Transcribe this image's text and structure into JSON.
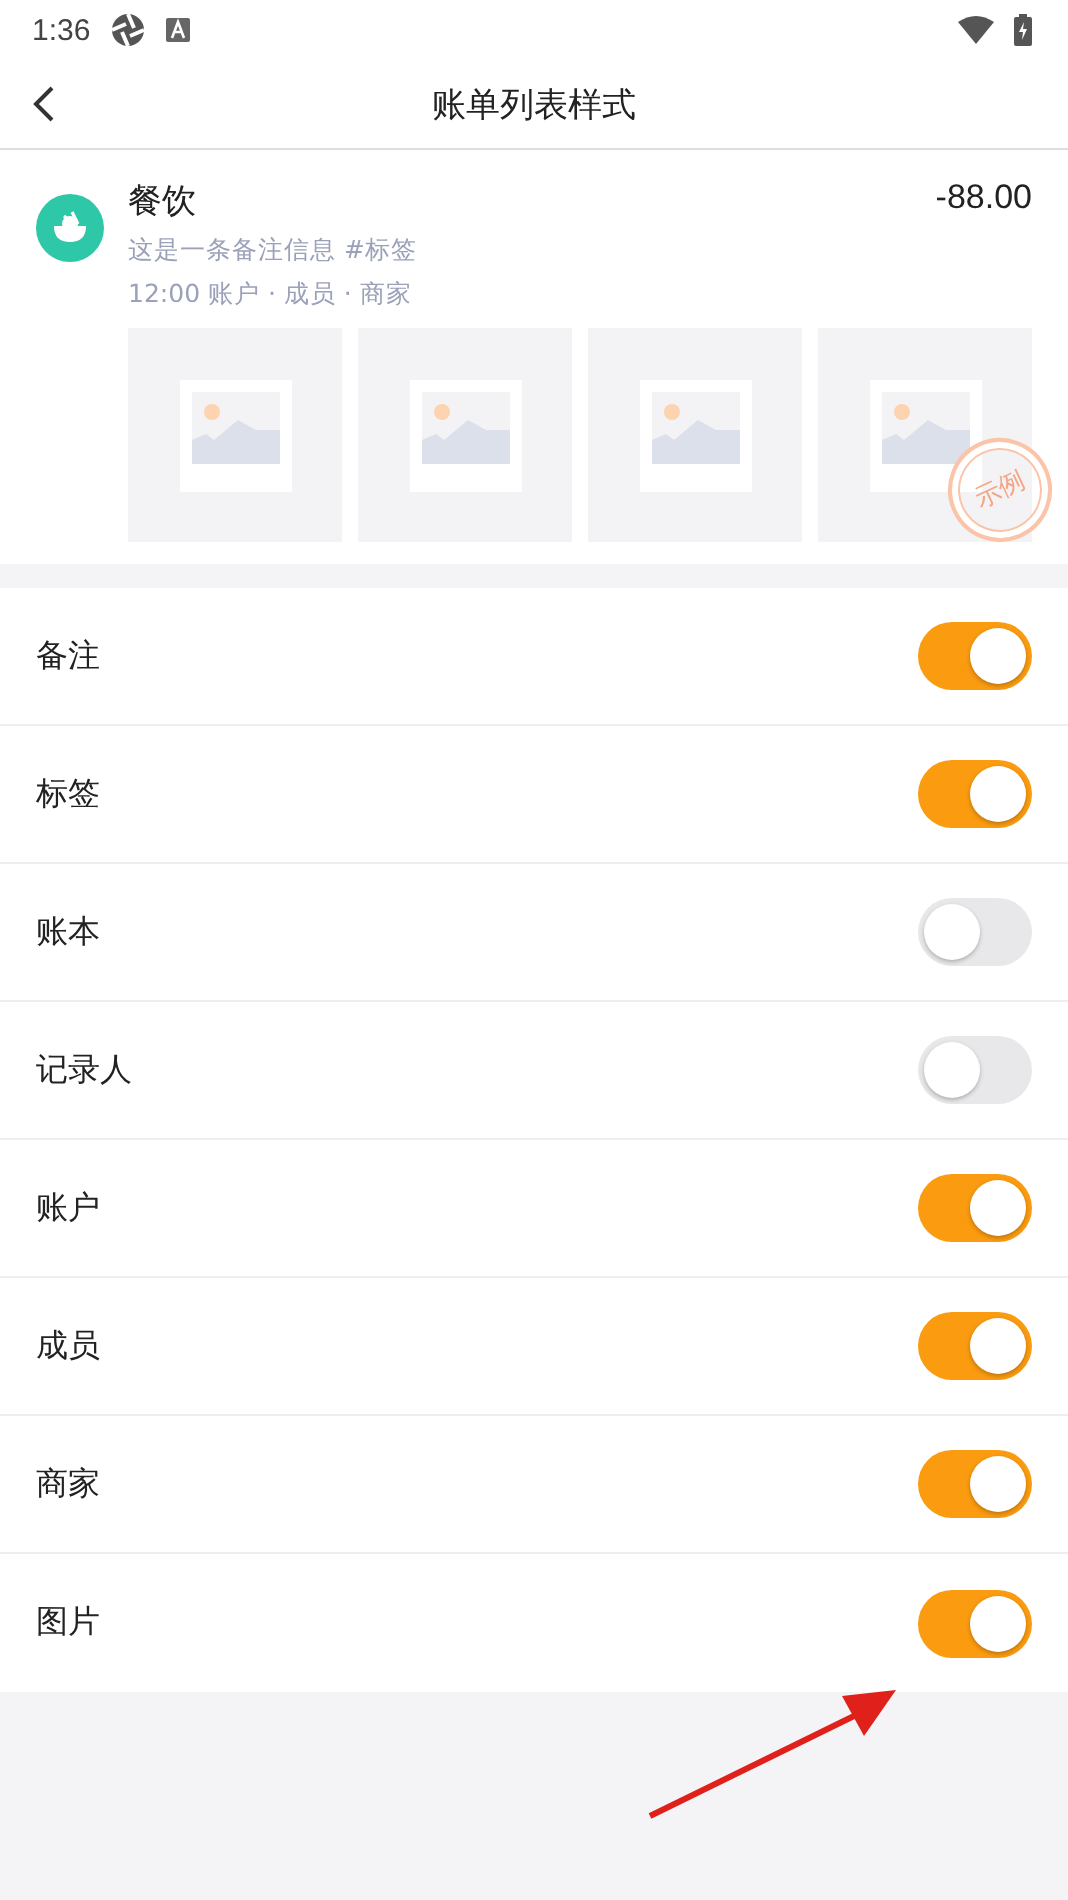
{
  "status_bar": {
    "time": "1:36"
  },
  "header": {
    "title": "账单列表样式"
  },
  "preview": {
    "category": "餐饮",
    "amount": "-88.00",
    "note": "这是一条备注信息 #标签",
    "meta": "12:00 账户 · 成员 · 商家",
    "images": [
      {
        "kind": "placeholder"
      },
      {
        "kind": "placeholder"
      },
      {
        "kind": "placeholder"
      },
      {
        "kind": "placeholder"
      }
    ],
    "stamp": "示例"
  },
  "settings": [
    {
      "label": "备注",
      "on": true
    },
    {
      "label": "标签",
      "on": true
    },
    {
      "label": "账本",
      "on": false
    },
    {
      "label": "记录人",
      "on": false
    },
    {
      "label": "账户",
      "on": true
    },
    {
      "label": "成员",
      "on": true
    },
    {
      "label": "商家",
      "on": true
    },
    {
      "label": "图片",
      "on": true
    }
  ]
}
